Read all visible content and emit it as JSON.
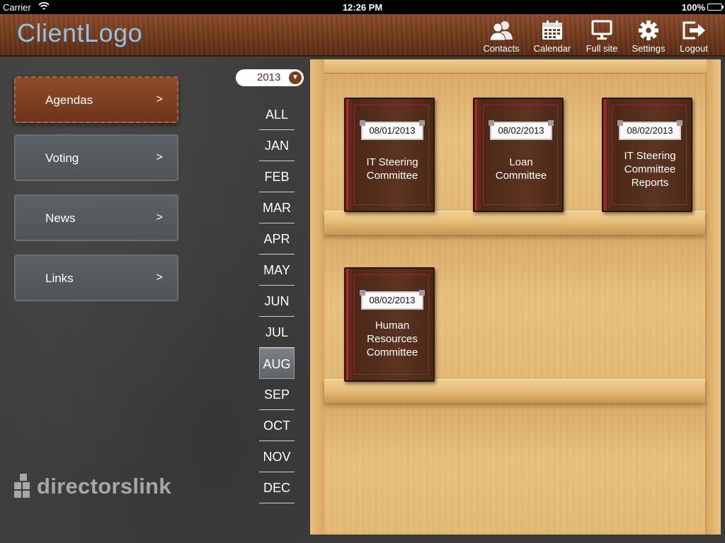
{
  "status_bar": {
    "carrier": "Carrier",
    "time": "12:26 PM",
    "battery": "100%"
  },
  "header": {
    "logo": "ClientLogo",
    "nav": [
      {
        "label": "Contacts",
        "icon": "contacts-icon"
      },
      {
        "label": "Calendar",
        "icon": "calendar-icon"
      },
      {
        "label": "Full site",
        "icon": "monitor-icon"
      },
      {
        "label": "Settings",
        "icon": "gear-icon"
      },
      {
        "label": "Logout",
        "icon": "logout-icon"
      }
    ]
  },
  "sidebar": {
    "items": [
      {
        "label": "Agendas",
        "chevron": ">",
        "active": true
      },
      {
        "label": "Voting",
        "chevron": ">"
      },
      {
        "label": "News",
        "chevron": ">"
      },
      {
        "label": "Links",
        "chevron": ">"
      }
    ],
    "brand": "directorslink"
  },
  "filter": {
    "year": "2013",
    "months": [
      "ALL",
      "JAN",
      "FEB",
      "MAR",
      "APR",
      "MAY",
      "JUN",
      "JUL",
      "AUG",
      "SEP",
      "OCT",
      "NOV",
      "DEC"
    ],
    "selected_month": "AUG"
  },
  "shelf": {
    "books": [
      {
        "date": "08/01/2013",
        "title_lines": [
          "IT Steering",
          "Committee"
        ]
      },
      {
        "date": "08/02/2013",
        "title_lines": [
          "Loan",
          "Committee"
        ]
      },
      {
        "date": "08/02/2013",
        "title_lines": [
          "IT Steering",
          "Committee",
          "Reports"
        ]
      },
      {
        "date": "08/02/2013",
        "title_lines": [
          "Human",
          "Resources",
          "Committee"
        ]
      }
    ]
  },
  "colors": {
    "logo": "#8fc3e6",
    "header_leather": "#70391c",
    "active_button": "#7e4122",
    "book_cover": "#5a3120",
    "shelf_wood": "#e3b975"
  }
}
